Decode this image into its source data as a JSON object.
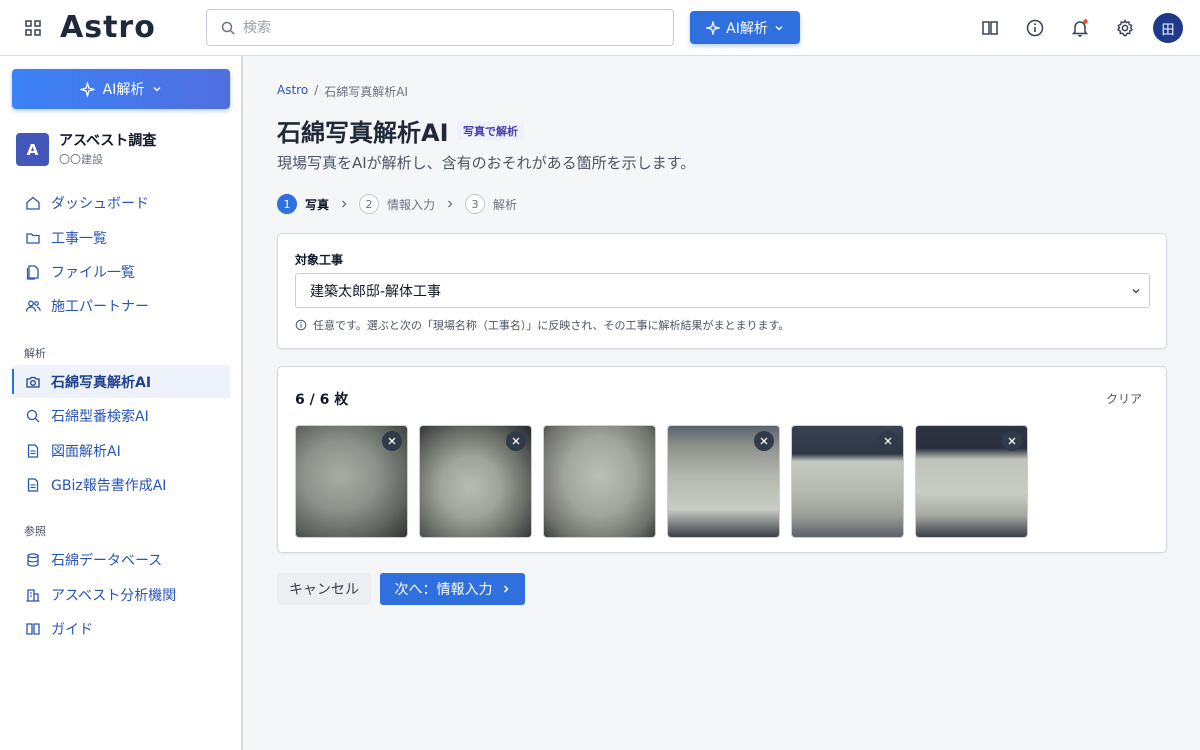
{
  "app": {
    "logo": "Astro"
  },
  "header": {
    "search_placeholder": "検索",
    "ai_button": "AI解析",
    "avatar": "田"
  },
  "sidebar": {
    "ai_button": "AI解析",
    "org": {
      "badge": "A",
      "name": "アスベスト調査",
      "sub": "〇〇建設"
    },
    "main_items": [
      {
        "label": "ダッシュボード",
        "icon": "home-icon"
      },
      {
        "label": "工事一覧",
        "icon": "folder-icon"
      },
      {
        "label": "ファイル一覧",
        "icon": "files-icon"
      },
      {
        "label": "施工パートナー",
        "icon": "users-icon"
      }
    ],
    "analysis_label": "解析",
    "analysis_items": [
      {
        "label": "石綿写真解析AI",
        "icon": "camera-icon",
        "active": true
      },
      {
        "label": "石綿型番検索AI",
        "icon": "search-icon"
      },
      {
        "label": "図面解析AI",
        "icon": "document-icon"
      },
      {
        "label": "GBiz報告書作成AI",
        "icon": "document-icon"
      }
    ],
    "reference_label": "参照",
    "reference_items": [
      {
        "label": "石綿データベース",
        "icon": "database-icon"
      },
      {
        "label": "アスベスト分析機関",
        "icon": "building-icon"
      },
      {
        "label": "ガイド",
        "icon": "book-icon"
      }
    ]
  },
  "main": {
    "breadcrumb": [
      "Astro",
      "石綿写真解析AI"
    ],
    "title": "石綿写真解析AI",
    "title_tag": "写真で解析",
    "description": "現場写真をAIが解析し、含有のおそれがある箇所を示します。",
    "steps": [
      {
        "num": "1",
        "label": "写真"
      },
      {
        "num": "2",
        "label": "情報入力"
      },
      {
        "num": "3",
        "label": "解析"
      }
    ],
    "project_field": {
      "label": "対象工事",
      "value": "建築太郎邸-解体工事",
      "help": "任意です。選ぶと次の「現場名称（工事名）」に反映され、その工事に解析結果がまとまります。"
    },
    "photos": {
      "count": "6 / 6 枚",
      "clear": "クリア",
      "total": 6
    },
    "buttons": {
      "cancel": "キャンセル",
      "next": "次へ：情報入力"
    }
  },
  "colors": {
    "primary": "#2f6fde",
    "active_bg": "#eef2fb"
  }
}
